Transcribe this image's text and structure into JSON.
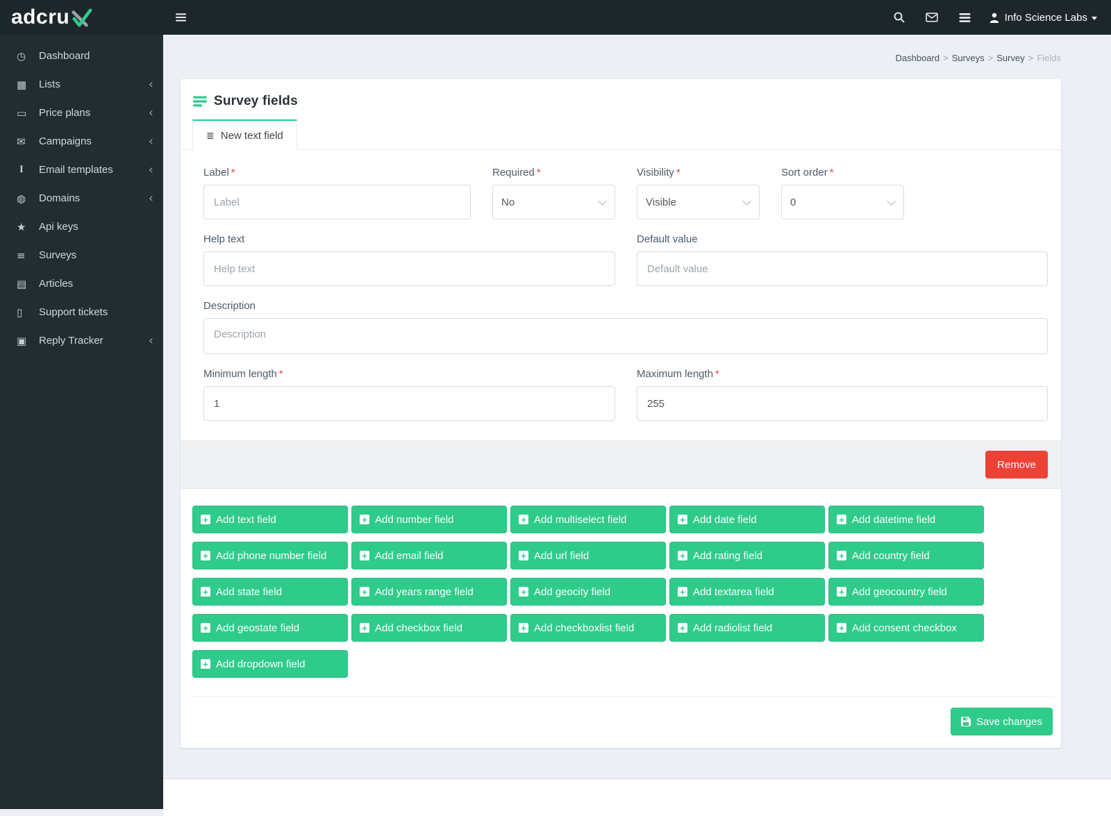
{
  "brand": {
    "name": "adcrux",
    "name_prefix": "adcru"
  },
  "navbar": {
    "user_label": "Info Science Labs",
    "icons": [
      "hamburger-icon",
      "search-icon",
      "envelope-icon",
      "stack-icon",
      "user-icon",
      "caret-down-icon"
    ]
  },
  "sidebar": {
    "chevron": "‹",
    "items": [
      {
        "label": "Dashboard",
        "icon": "dashboard-icon",
        "glyph": "◷",
        "expandable": false
      },
      {
        "label": "Lists",
        "icon": "lists-icon",
        "glyph": "▦",
        "expandable": true
      },
      {
        "label": "Price plans",
        "icon": "price-plans-icon",
        "glyph": "▭",
        "expandable": true
      },
      {
        "label": "Campaigns",
        "icon": "campaigns-icon",
        "glyph": "✉",
        "expandable": true
      },
      {
        "label": "Email templates",
        "icon": "email-templates-icon",
        "glyph": "I",
        "expandable": true
      },
      {
        "label": "Domains",
        "icon": "domains-icon",
        "glyph": "◍",
        "expandable": true
      },
      {
        "label": "Api keys",
        "icon": "api-keys-icon",
        "glyph": "★",
        "expandable": false
      },
      {
        "label": "Surveys",
        "icon": "surveys-icon",
        "glyph": "≡",
        "expandable": false
      },
      {
        "label": "Articles",
        "icon": "articles-icon",
        "glyph": "▤",
        "expandable": false
      },
      {
        "label": "Support tickets",
        "icon": "support-tickets-icon",
        "glyph": "▯",
        "expandable": false
      },
      {
        "label": "Reply Tracker",
        "icon": "reply-tracker-icon",
        "glyph": "▣",
        "expandable": true
      }
    ]
  },
  "breadcrumb": {
    "separator": ">",
    "items": [
      "Dashboard",
      "Surveys",
      "Survey",
      "Fields"
    ]
  },
  "page": {
    "title": "Survey fields",
    "title_icon": "list-icon",
    "required_mark": "*",
    "tab": {
      "label": "New text field",
      "icon": "th-list-icon",
      "glyph": "≣"
    },
    "form": {
      "label": {
        "label": "Label",
        "placeholder": "Label"
      },
      "required": {
        "label": "Required",
        "value": "No"
      },
      "visibility": {
        "label": "Visibility",
        "value": "Visible"
      },
      "sort_order": {
        "label": "Sort order",
        "value": "0"
      },
      "help_text": {
        "label": "Help text",
        "placeholder": "Help text"
      },
      "default_value": {
        "label": "Default value",
        "placeholder": "Default value"
      },
      "description": {
        "label": "Description",
        "placeholder": "Description"
      },
      "minimum_length": {
        "label": "Minimum length",
        "value": "1"
      },
      "maximum_length": {
        "label": "Maximum length",
        "value": "255"
      },
      "remove_button": "Remove"
    },
    "add_buttons": [
      "Add text field",
      "Add number field",
      "Add multiselect field",
      "Add date field",
      "Add datetime field",
      "Add phone number field",
      "Add email field",
      "Add url field",
      "Add rating field",
      "Add country field",
      "Add state field",
      "Add years range field",
      "Add geocity field",
      "Add textarea field",
      "Add geocountry field",
      "Add geostate field",
      "Add checkbox field",
      "Add checkboxlist field",
      "Add radiolist field",
      "Add consent checkbox",
      "Add dropdown field"
    ],
    "save_button": "Save changes"
  },
  "colors": {
    "accent_green": "#2FCB8B",
    "danger_red": "#EE4136",
    "sidebar_dark": "#222d32",
    "navbar_dark": "#1d262b",
    "content_bg": "#ecf0f5"
  }
}
